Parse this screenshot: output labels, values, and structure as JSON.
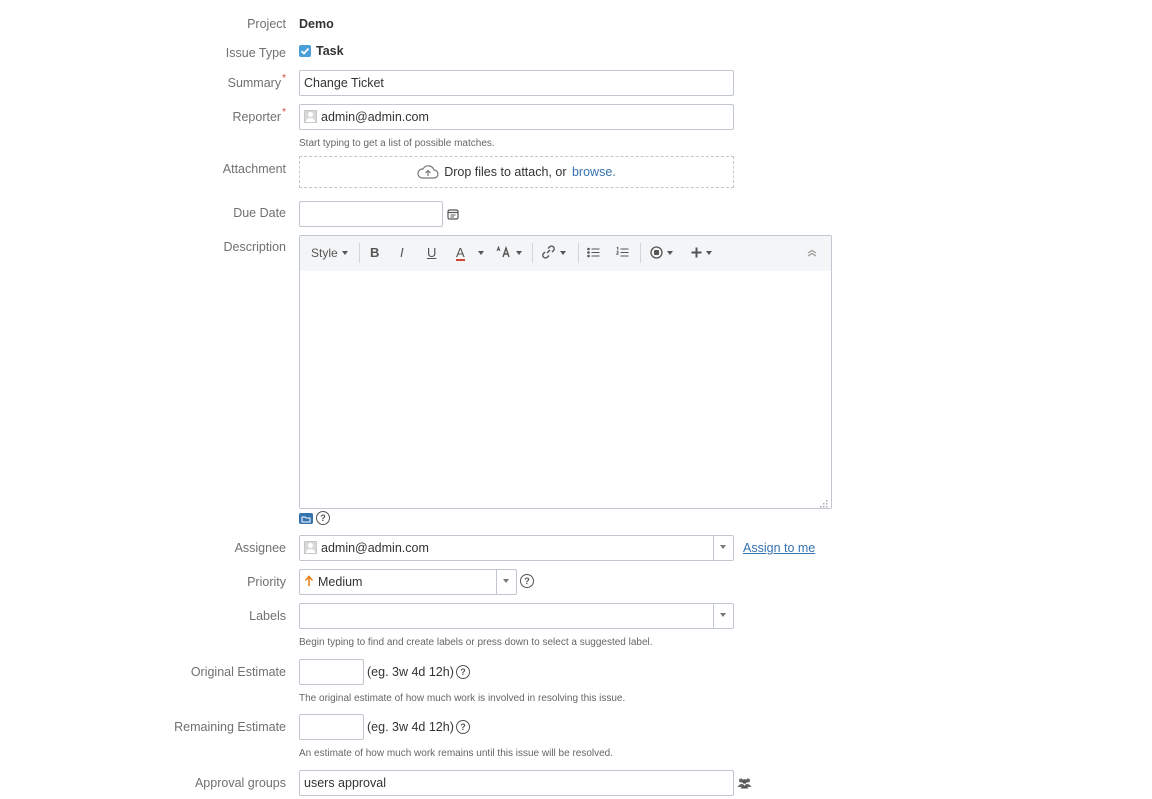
{
  "labels": {
    "project": "Project",
    "issue_type": "Issue Type",
    "summary": "Summary",
    "reporter": "Reporter",
    "attachment": "Attachment",
    "due_date": "Due Date",
    "description": "Description",
    "assignee": "Assignee",
    "priority": "Priority",
    "labels": "Labels",
    "original_estimate": "Original Estimate",
    "remaining_estimate": "Remaining Estimate",
    "approval_groups": "Approval groups"
  },
  "required_mark": "*",
  "values": {
    "project": "Demo",
    "issue_type": "Task",
    "summary": "Change Ticket",
    "reporter": "admin@admin.com",
    "due_date": "",
    "assignee": "admin@admin.com",
    "priority": "Medium",
    "labels": "",
    "original_estimate": "",
    "remaining_estimate": "",
    "approval_groups": "users approval"
  },
  "help": {
    "reporter": "Start typing to get a list of possible matches.",
    "labels": "Begin typing to find and create labels or press down to select a suggested label.",
    "original_estimate": "The original estimate of how much work is involved in resolving this issue.",
    "remaining_estimate": "An estimate of how much work remains until this issue will be resolved."
  },
  "attachment": {
    "drop_text": "Drop files to attach, or",
    "browse_link": "browse."
  },
  "editor": {
    "style_label": "Style",
    "bold": "B",
    "italic": "I",
    "underline": "U",
    "text_color": "A"
  },
  "assign_to_me": "Assign to me",
  "estimate_hint": "(eg. 3w 4d 12h)",
  "colors": {
    "accent": "#3572b0",
    "required": "#d04437",
    "checkbox": "#4a9fd8",
    "priority_arrow": "#e8821e"
  }
}
